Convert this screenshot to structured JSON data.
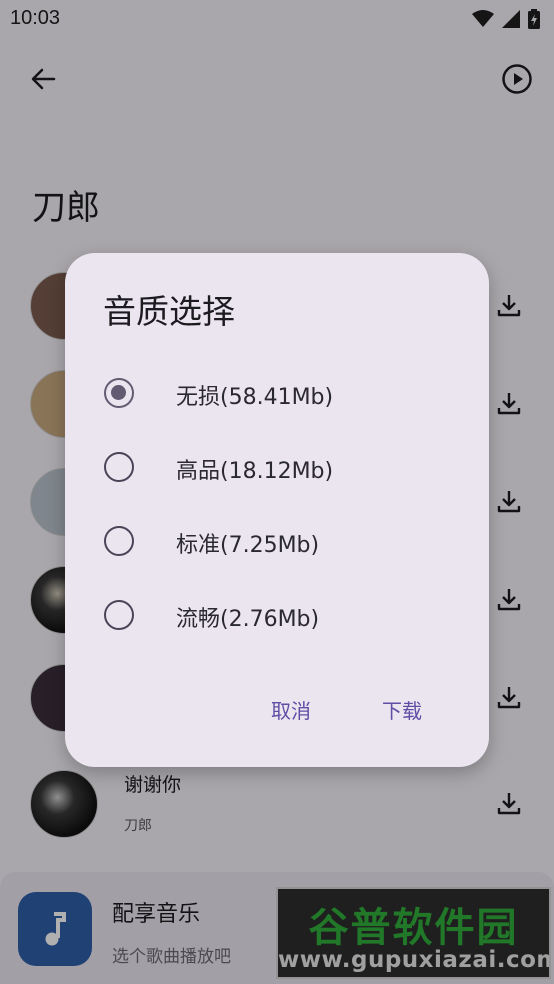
{
  "status_bar": {
    "time": "10:03"
  },
  "page": {
    "title": "刀郎"
  },
  "songs": [
    {
      "title": "",
      "artist": ""
    },
    {
      "title": "",
      "artist": ""
    },
    {
      "title": "",
      "artist": ""
    },
    {
      "title": "",
      "artist": ""
    },
    {
      "title": "",
      "artist": ""
    },
    {
      "title": "谢谢你",
      "artist": "刀郎"
    }
  ],
  "player": {
    "title": "配享音乐",
    "subtitle": "选个歌曲播放吧"
  },
  "dialog": {
    "title": "音质选择",
    "options": [
      {
        "label": "无损(58.41Mb)",
        "selected": true
      },
      {
        "label": "高品(18.12Mb)",
        "selected": false
      },
      {
        "label": "标准(7.25Mb)",
        "selected": false
      },
      {
        "label": "流畅(2.76Mb)",
        "selected": false
      }
    ],
    "cancel_label": "取消",
    "confirm_label": "下载"
  },
  "watermark": {
    "brand": "谷普软件园",
    "url": "www.gupuxiazai.com"
  },
  "colors": {
    "accent": "#625b71",
    "button_text": "#5e4fa5",
    "dialog_bg": "#ebe5f0"
  }
}
